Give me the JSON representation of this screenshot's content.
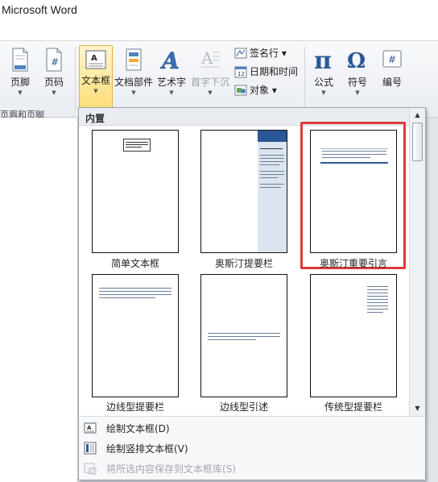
{
  "window": {
    "title": "Microsoft Word"
  },
  "ribbon": {
    "buttons": [
      {
        "label": "页脚",
        "icon": "footer-icon"
      },
      {
        "label": "页码",
        "icon": "page-number-icon"
      },
      {
        "label": "文本框",
        "icon": "textbox-icon"
      },
      {
        "label": "文档部件",
        "icon": "quick-parts-icon"
      },
      {
        "label": "艺术字",
        "icon": "wordart-icon"
      },
      {
        "label": "首字下沉",
        "icon": "drop-cap-icon"
      },
      {
        "label": "公式",
        "icon": "pi-icon"
      },
      {
        "label": "符号",
        "icon": "omega-icon"
      },
      {
        "label": "编号",
        "icon": "number-icon"
      }
    ],
    "small_buttons": [
      {
        "label": "签名行 ▾",
        "icon": "signature-line-icon"
      },
      {
        "label": "日期和时间",
        "icon": "date-time-icon"
      },
      {
        "label": "对象 ▾",
        "icon": "object-icon"
      }
    ],
    "group_label": "页眉和页脚"
  },
  "gallery": {
    "section_title": "内置",
    "items": [
      {
        "caption": "简单文本框"
      },
      {
        "caption": "奥斯汀提要栏"
      },
      {
        "caption": "奥斯汀重要引言"
      },
      {
        "caption": "边线型提要栏"
      },
      {
        "caption": "边线型引述"
      },
      {
        "caption": "传统型提要栏"
      }
    ],
    "highlighted_item": "奥斯汀重要引言",
    "highlight_color": "#e0393b"
  },
  "menu": {
    "items": [
      {
        "label": "绘制文本框(D)",
        "icon": "draw-textbox-icon",
        "enabled": true
      },
      {
        "label": "绘制竖排文本框(V)",
        "icon": "draw-vertical-textbox-icon",
        "enabled": true
      },
      {
        "label": "将所选内容保存到文本框库(S)",
        "icon": "save-selection-icon",
        "enabled": false
      }
    ]
  },
  "colors": {
    "selected_button": "#ffdd7a",
    "accent_blue": "#2b5797"
  }
}
